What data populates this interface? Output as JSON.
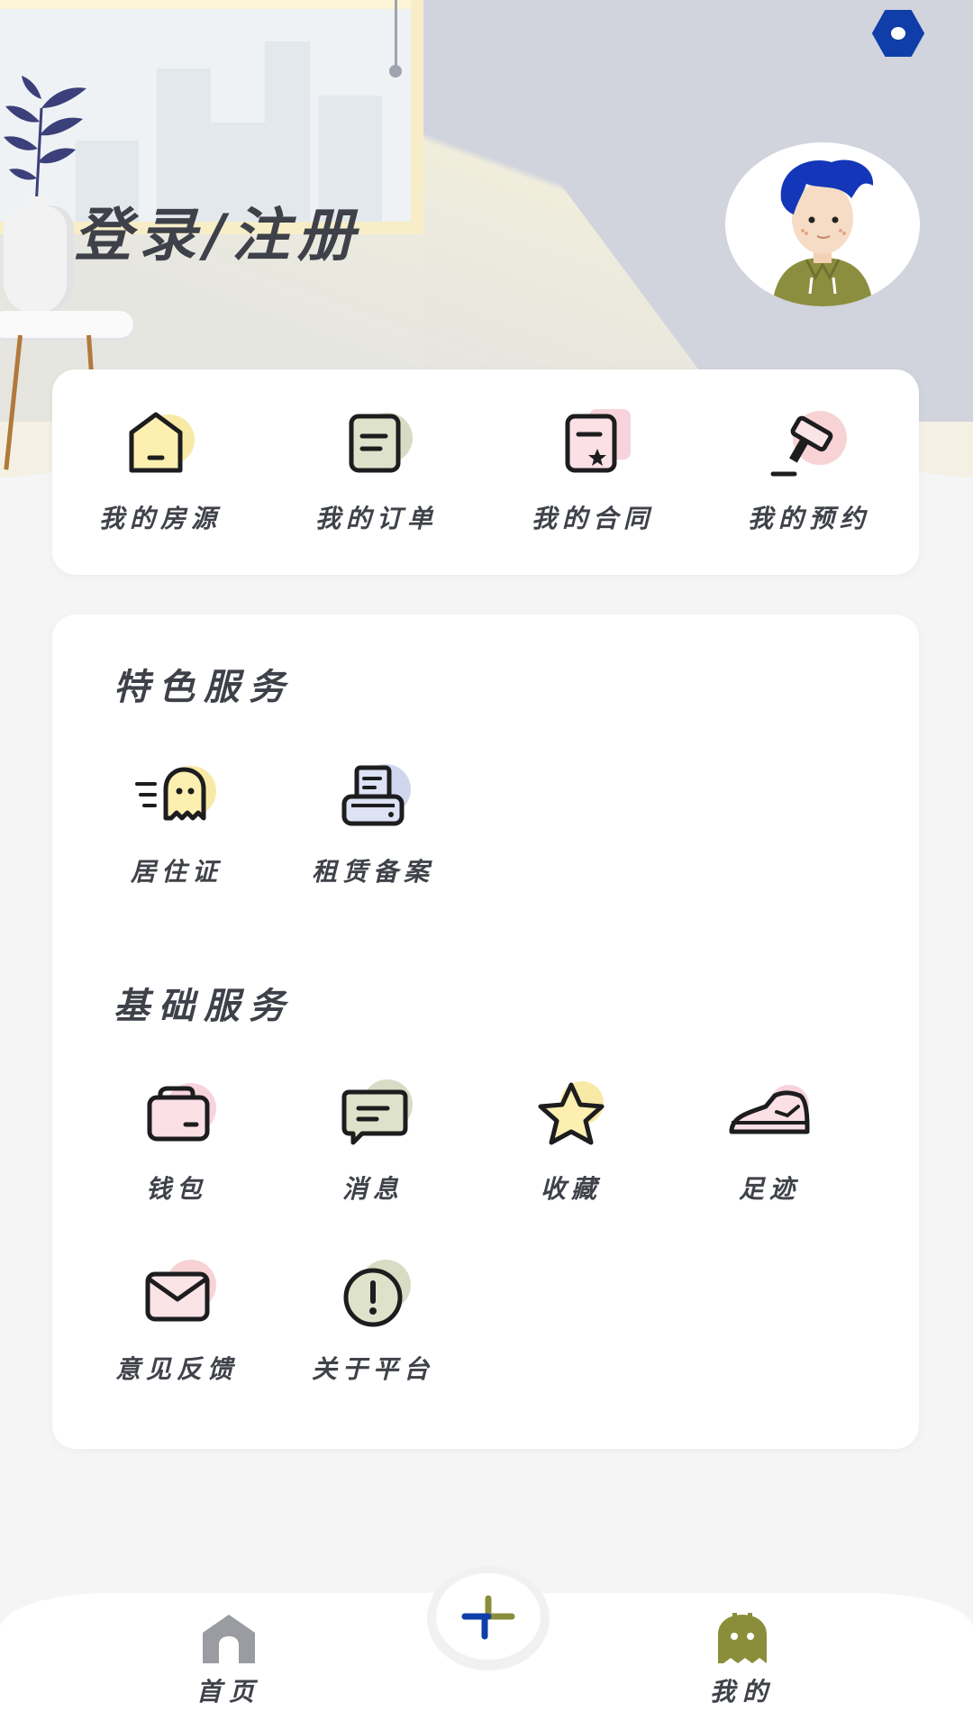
{
  "header": {
    "login_title": "登录/注册",
    "settings_icon": "hexagon-settings-icon",
    "avatar_icon": "user-avatar-icon"
  },
  "quick_actions": [
    {
      "label": "我的房源",
      "icon": "house-icon",
      "accent": "#f8e9a6"
    },
    {
      "label": "我的订单",
      "icon": "order-note-icon",
      "accent": "#d9dcc4"
    },
    {
      "label": "我的合同",
      "icon": "contract-icon",
      "accent": "#f7d3dc"
    },
    {
      "label": "我的预约",
      "icon": "gavel-icon",
      "accent": "#f7d3d5"
    }
  ],
  "featured_services": {
    "title": "特色服务",
    "items": [
      {
        "label": "居住证",
        "icon": "ghost-card-icon",
        "accent": "#f8e9a6"
      },
      {
        "label": "租赁备案",
        "icon": "printer-icon",
        "accent": "#cfd6ee"
      }
    ]
  },
  "basic_services": {
    "title": "基础服务",
    "items": [
      {
        "label": "钱包",
        "icon": "wallet-icon",
        "accent": "#f7d3dc"
      },
      {
        "label": "消息",
        "icon": "message-icon",
        "accent": "#d9dcc4"
      },
      {
        "label": "收藏",
        "icon": "star-icon",
        "accent": "#f8e9a6"
      },
      {
        "label": "足迹",
        "icon": "sneaker-icon",
        "accent": "#f7d3dc"
      },
      {
        "label": "意见反馈",
        "icon": "mail-icon",
        "accent": "#f7d3d5"
      },
      {
        "label": "关于平台",
        "icon": "info-icon",
        "accent": "#d9dcc4"
      }
    ]
  },
  "bottom_nav": {
    "home_label": "首页",
    "mine_label": "我的",
    "add_icon": "plus-icon"
  },
  "colors": {
    "icon_stroke": "#1d1d1f",
    "brand_blue": "#0f3ea8",
    "olive": "#8a8e3a",
    "nav_gray": "#9a9ca1"
  }
}
